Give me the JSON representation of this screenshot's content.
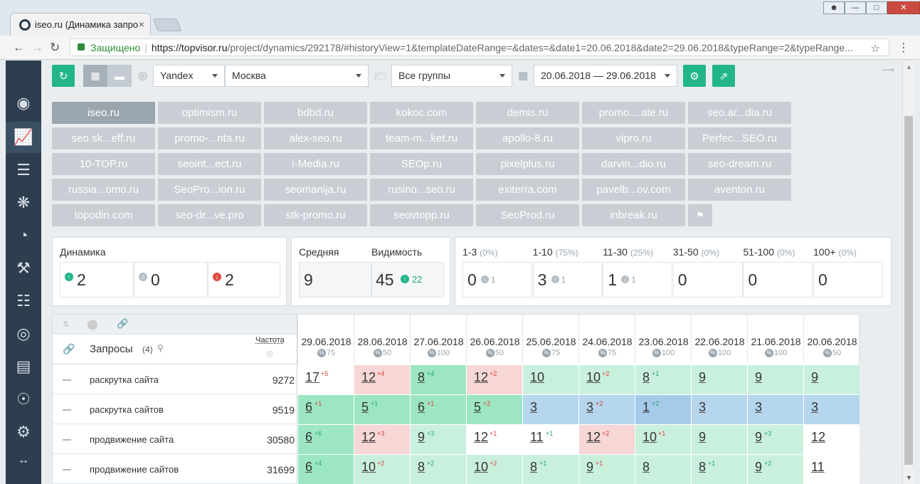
{
  "browser": {
    "tab_title": "iseo.ru (Динамика запро",
    "tab_close": "×",
    "secure_label": "Защищено",
    "url_host": "https://topvisor.ru",
    "url_path": "/project/dynamics/292178/#historyView=1&templateDateRange=&dates=&date1=20.06.2018&date2=29.06.2018&typeRange=2&typeRange..."
  },
  "toolbar": {
    "search_engine": "Yandex",
    "region": "Москва",
    "group": "Все группы",
    "date_range": "20.06.2018 — 29.06.2018"
  },
  "domains": [
    [
      "iseo.ru",
      "optimism.ru",
      "bdbd.ru",
      "kokoc.com",
      "demis.ru",
      "promo....ate.ru",
      "seo.ar...dia.ru"
    ],
    [
      "seo.sk...eff.ru",
      "promo-...nta.ru",
      "alex-seo.ru",
      "team-m...ket.ru",
      "apollo-8.ru",
      "vipro.ru",
      "Perfec...SEO.ru"
    ],
    [
      "10-TOP.ru",
      "seoint...ect.ru",
      "i-Media.ru",
      "SEOp.ru",
      "pixelplus.ru",
      "darvin...dio.ru",
      "seo-dream.ru"
    ],
    [
      "russia...omo.ru",
      "SeoPro...ion.ru",
      "seomanija.ru",
      "rusino...seo.ru",
      "exiterra.com",
      "pavelb...ov.com",
      "aventon.ru"
    ],
    [
      "topodin.com",
      "seo-dr...ve.pro",
      "stk-promo.ru",
      "seovtopp.ru",
      "SeoProd.ru",
      "inbreak.ru"
    ]
  ],
  "dynamics": {
    "title": "Динамика",
    "up": "2",
    "same": "0",
    "down": "2"
  },
  "average": {
    "avg_label": "Средняя",
    "vis_label": "Видимость",
    "avg_value": "9",
    "vis_value": "45",
    "vis_delta": "22"
  },
  "ranges": [
    {
      "label": "1-3",
      "pct": "(0%)",
      "value": "0",
      "delta": "1",
      "dir": "down"
    },
    {
      "label": "1-10",
      "pct": "(75%)",
      "value": "3",
      "delta": "1",
      "dir": "up"
    },
    {
      "label": "11-30",
      "pct": "(25%)",
      "value": "1",
      "delta": "1",
      "dir": "down"
    },
    {
      "label": "31-50",
      "pct": "(0%)",
      "value": "0",
      "delta": "",
      "dir": ""
    },
    {
      "label": "51-100",
      "pct": "(0%)",
      "value": "0",
      "delta": "",
      "dir": ""
    },
    {
      "label": "100+",
      "pct": "(0%)",
      "value": "0",
      "delta": "",
      "dir": ""
    }
  ],
  "table": {
    "queries_label": "Запросы",
    "queries_count": "(4)",
    "freq_label": "Частота",
    "dates": [
      {
        "date": "29.06.2018",
        "pct": "75"
      },
      {
        "date": "28.06.2018",
        "pct": "50"
      },
      {
        "date": "27.06.2018",
        "pct": "100"
      },
      {
        "date": "26.06.2018",
        "pct": "50"
      },
      {
        "date": "25.06.2018",
        "pct": "75"
      },
      {
        "date": "24.06.2018",
        "pct": "75"
      },
      {
        "date": "23.06.2018",
        "pct": "100"
      },
      {
        "date": "22.06.2018",
        "pct": "100"
      },
      {
        "date": "21.06.2018",
        "pct": "100"
      },
      {
        "date": "20.06.2018",
        "pct": "50"
      }
    ],
    "rows": [
      {
        "query": "раскрутка сайта",
        "freq": "9272",
        "cells": [
          {
            "v": "17",
            "d": "+5",
            "s": "n",
            "c": "white"
          },
          {
            "v": "12",
            "d": "+4",
            "s": "n",
            "c": "red"
          },
          {
            "v": "8",
            "d": "+4",
            "s": "p",
            "c": "green"
          },
          {
            "v": "12",
            "d": "+2",
            "s": "n",
            "c": "red"
          },
          {
            "v": "10",
            "d": "",
            "s": "",
            "c": "lgreen"
          },
          {
            "v": "10",
            "d": "+2",
            "s": "n",
            "c": "lgreen"
          },
          {
            "v": "8",
            "d": "+1",
            "s": "p",
            "c": "lgreen"
          },
          {
            "v": "9",
            "d": "",
            "s": "",
            "c": "lgreen"
          },
          {
            "v": "9",
            "d": "",
            "s": "",
            "c": "lgreen"
          },
          {
            "v": "9",
            "d": "",
            "s": "",
            "c": "lgreen"
          }
        ]
      },
      {
        "query": "раскрутка сайтов",
        "freq": "9519",
        "cells": [
          {
            "v": "6",
            "d": "+1",
            "s": "n",
            "c": "green"
          },
          {
            "v": "5",
            "d": "+1",
            "s": "p",
            "c": "green"
          },
          {
            "v": "6",
            "d": "+1",
            "s": "n",
            "c": "green"
          },
          {
            "v": "5",
            "d": "+2",
            "s": "n",
            "c": "green"
          },
          {
            "v": "3",
            "d": "",
            "s": "",
            "c": "blue"
          },
          {
            "v": "3",
            "d": "+2",
            "s": "n",
            "c": "blue"
          },
          {
            "v": "1",
            "d": "+2",
            "s": "p",
            "c": "blue2"
          },
          {
            "v": "3",
            "d": "",
            "s": "",
            "c": "blue"
          },
          {
            "v": "3",
            "d": "",
            "s": "",
            "c": "blue"
          },
          {
            "v": "3",
            "d": "",
            "s": "",
            "c": "blue"
          }
        ]
      },
      {
        "query": "продвижение сайта",
        "freq": "30580",
        "cells": [
          {
            "v": "6",
            "d": "+6",
            "s": "p",
            "c": "green"
          },
          {
            "v": "12",
            "d": "+3",
            "s": "n",
            "c": "red"
          },
          {
            "v": "9",
            "d": "+3",
            "s": "p",
            "c": "lgreen"
          },
          {
            "v": "12",
            "d": "+1",
            "s": "n",
            "c": "white"
          },
          {
            "v": "11",
            "d": "+1",
            "s": "p",
            "c": "white"
          },
          {
            "v": "12",
            "d": "+2",
            "s": "n",
            "c": "red"
          },
          {
            "v": "10",
            "d": "+1",
            "s": "n",
            "c": "lgreen"
          },
          {
            "v": "9",
            "d": "",
            "s": "",
            "c": "lgreen"
          },
          {
            "v": "9",
            "d": "+3",
            "s": "p",
            "c": "lgreen"
          },
          {
            "v": "12",
            "d": "",
            "s": "",
            "c": "white"
          }
        ]
      },
      {
        "query": "продвижение сайтов",
        "freq": "31699",
        "cells": [
          {
            "v": "6",
            "d": "+4",
            "s": "p",
            "c": "green"
          },
          {
            "v": "10",
            "d": "+2",
            "s": "n",
            "c": "lgreen"
          },
          {
            "v": "8",
            "d": "+2",
            "s": "p",
            "c": "lgreen"
          },
          {
            "v": "10",
            "d": "+2",
            "s": "n",
            "c": "lgreen"
          },
          {
            "v": "8",
            "d": "+1",
            "s": "p",
            "c": "lgreen"
          },
          {
            "v": "9",
            "d": "+1",
            "s": "n",
            "c": "lgreen"
          },
          {
            "v": "8",
            "d": "",
            "s": "",
            "c": "lgreen"
          },
          {
            "v": "8",
            "d": "+1",
            "s": "p",
            "c": "lgreen"
          },
          {
            "v": "9",
            "d": "+2",
            "s": "p",
            "c": "lgreen"
          },
          {
            "v": "11",
            "d": "",
            "s": "",
            "c": "white"
          }
        ]
      }
    ]
  }
}
